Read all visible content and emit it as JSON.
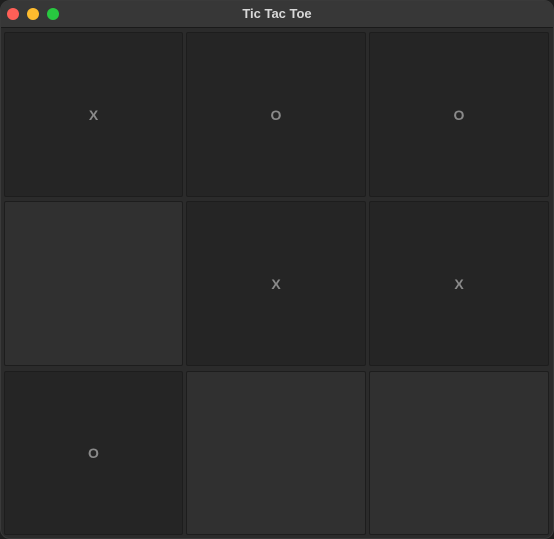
{
  "window": {
    "title": "Tic Tac Toe",
    "colors": {
      "close": "#ff5f57",
      "minimize": "#febc2e",
      "zoom": "#28c840"
    }
  },
  "board": {
    "cells": [
      {
        "mark": "X",
        "state": "filled",
        "color": "#252525"
      },
      {
        "mark": "O",
        "state": "filled",
        "color": "#252525"
      },
      {
        "mark": "O",
        "state": "filled",
        "color": "#252525"
      },
      {
        "mark": "",
        "state": "empty",
        "color": "#303030"
      },
      {
        "mark": "X",
        "state": "filled",
        "color": "#252525"
      },
      {
        "mark": "X",
        "state": "filled",
        "color": "#252525"
      },
      {
        "mark": "O",
        "state": "filled",
        "color": "#252525"
      },
      {
        "mark": "",
        "state": "empty",
        "color": "#303030"
      },
      {
        "mark": "",
        "state": "empty",
        "color": "#303030"
      }
    ]
  }
}
